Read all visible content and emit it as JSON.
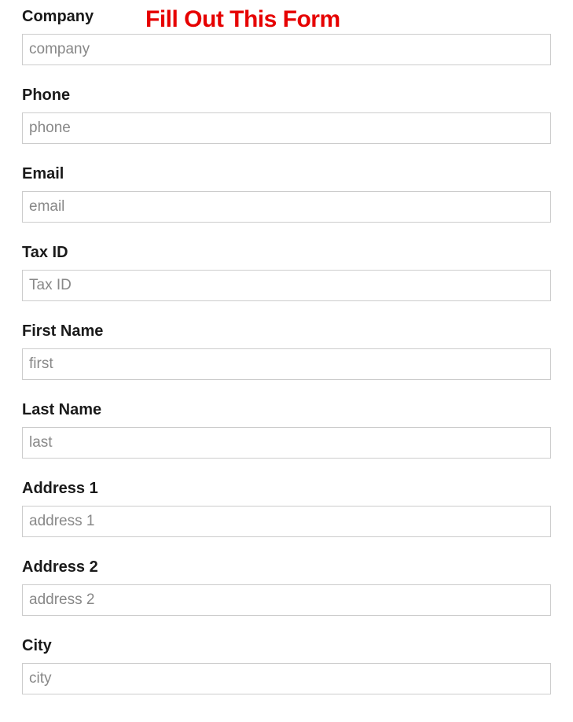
{
  "form": {
    "title": "Fill Out This Form",
    "fields": {
      "company": {
        "label": "Company",
        "placeholder": "company"
      },
      "phone": {
        "label": "Phone",
        "placeholder": "phone"
      },
      "email": {
        "label": "Email",
        "placeholder": "email"
      },
      "tax_id": {
        "label": "Tax ID",
        "placeholder": "Tax ID"
      },
      "first_name": {
        "label": "First Name",
        "placeholder": "first"
      },
      "last_name": {
        "label": "Last Name",
        "placeholder": "last"
      },
      "address_1": {
        "label": "Address 1",
        "placeholder": "address 1"
      },
      "address_2": {
        "label": "Address 2",
        "placeholder": "address 2"
      },
      "city": {
        "label": "City",
        "placeholder": "city"
      }
    }
  }
}
